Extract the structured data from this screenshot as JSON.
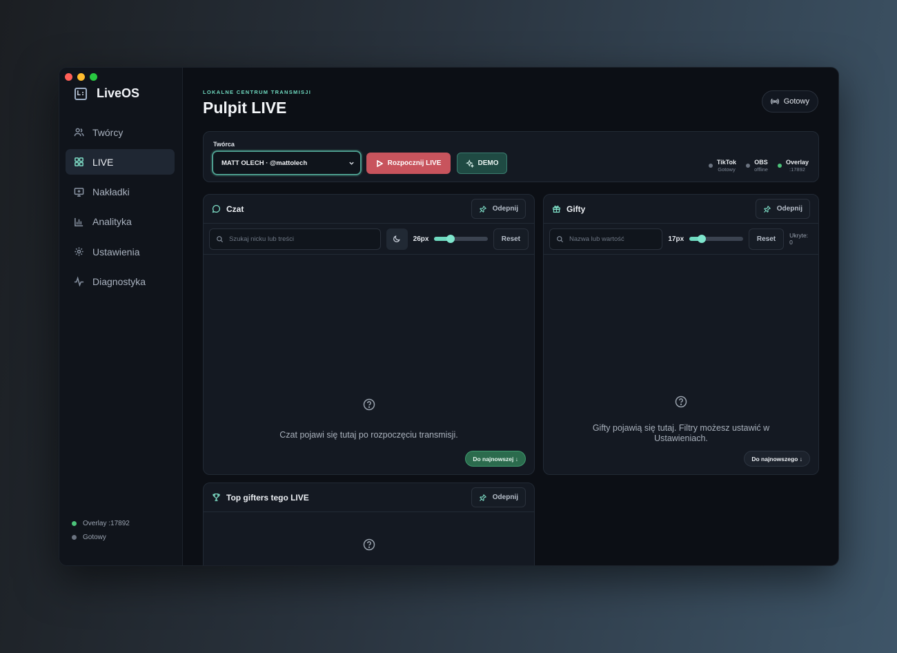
{
  "app": {
    "name": "LiveOS",
    "logo_glyph": "L:"
  },
  "colors": {
    "accent": "#6fd9bf",
    "danger": "#c8545d",
    "online": "#4cc37a",
    "offline": "#6b7380"
  },
  "sidebar": {
    "items": [
      {
        "label": "Twórcy",
        "icon": "users-icon"
      },
      {
        "label": "LIVE",
        "icon": "grid-icon",
        "active": true
      },
      {
        "label": "Nakładki",
        "icon": "monitor-icon"
      },
      {
        "label": "Analityka",
        "icon": "bar-chart-icon"
      },
      {
        "label": "Ustawienia",
        "icon": "gear-icon"
      },
      {
        "label": "Diagnostyka",
        "icon": "pulse-icon"
      }
    ],
    "status": [
      {
        "label": "Overlay :17892",
        "state": "online"
      },
      {
        "label": "Gotowy",
        "state": "offline"
      }
    ]
  },
  "header": {
    "eyebrow": "LOKALNE CENTRUM TRANSMISJI",
    "title": "Pulpit LIVE",
    "ready_label": "Gotowy"
  },
  "topbar": {
    "creator_label": "Twórca",
    "creator_value": "MATT OLECH · @mattolech",
    "start_label": "Rozpocznij LIVE",
    "demo_label": "DEMO",
    "statuses": [
      {
        "name": "TikTok",
        "value": "Gotowy",
        "state": "offline"
      },
      {
        "name": "OBS",
        "value": "offline",
        "state": "offline"
      },
      {
        "name": "Overlay",
        "value": ":17892",
        "state": "online"
      }
    ]
  },
  "chat": {
    "title": "Czat",
    "unpin_label": "Odepnij",
    "search_placeholder": "Szukaj nicku lub treści",
    "font_size_label": "26px",
    "font_size_level": 0.3,
    "reset_label": "Reset",
    "empty_text": "Czat pojawi się tutaj po rozpoczęciu transmisji.",
    "jump_label": "Do najnowszej ↓"
  },
  "gifts": {
    "title": "Gifty",
    "unpin_label": "Odepnij",
    "search_placeholder": "Nazwa lub wartość",
    "font_size_label": "17px",
    "font_size_level": 0.23,
    "reset_label": "Reset",
    "hidden_label": "Ukryte: 0",
    "empty_text": "Gifty pojawią się tutaj. Filtry możesz ustawić w Ustawieniach.",
    "jump_label": "Do najnowszego ↓"
  },
  "top_gifters": {
    "title": "Top gifters tego LIVE",
    "unpin_label": "Odepnij"
  }
}
